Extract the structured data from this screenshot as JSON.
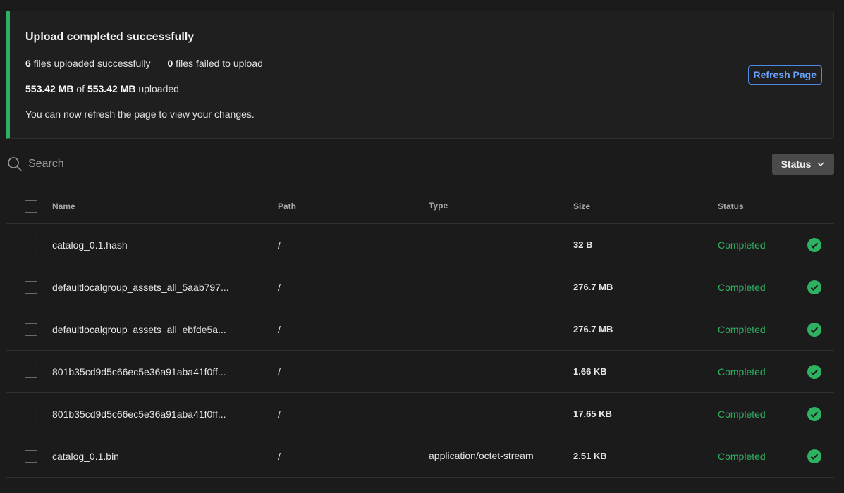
{
  "banner": {
    "title": "Upload completed successfully",
    "success_count": "6",
    "success_label": " files uploaded successfully",
    "failed_count": "0",
    "failed_label": " files failed to upload",
    "uploaded_size": "553.42 MB",
    "of_label": " of ",
    "total_size": "553.42 MB",
    "uploaded_label": " uploaded",
    "message": "You can now refresh the page to view your changes.",
    "refresh_label": "Refresh Page",
    "accent_color": "#2fb162"
  },
  "search": {
    "placeholder": "Search",
    "icon": "search-icon"
  },
  "filter": {
    "status_label": "Status",
    "icon": "chevron-down-icon"
  },
  "table": {
    "columns": {
      "name": "Name",
      "path": "Path",
      "type": "Type",
      "size": "Size",
      "status": "Status"
    },
    "rows": [
      {
        "name": "catalog_0.1.hash",
        "path": "/",
        "type": "",
        "size": "32 B",
        "status": "Completed"
      },
      {
        "name": "defaultlocalgroup_assets_all_5aab797...",
        "path": "/",
        "type": "",
        "size": "276.7 MB",
        "status": "Completed"
      },
      {
        "name": "defaultlocalgroup_assets_all_ebfde5a...",
        "path": "/",
        "type": "",
        "size": "276.7 MB",
        "status": "Completed"
      },
      {
        "name": "801b35cd9d5c66ec5e36a91aba41f0ff...",
        "path": "/",
        "type": "",
        "size": "1.66 KB",
        "status": "Completed"
      },
      {
        "name": "801b35cd9d5c66ec5e36a91aba41f0ff...",
        "path": "/",
        "type": "",
        "size": "17.65 KB",
        "status": "Completed"
      },
      {
        "name": "catalog_0.1.bin",
        "path": "/",
        "type": "application/octet-stream",
        "size": "2.51 KB",
        "status": "Completed"
      }
    ],
    "status_color": "#2fb162",
    "status_icon": "check-circle-icon"
  }
}
